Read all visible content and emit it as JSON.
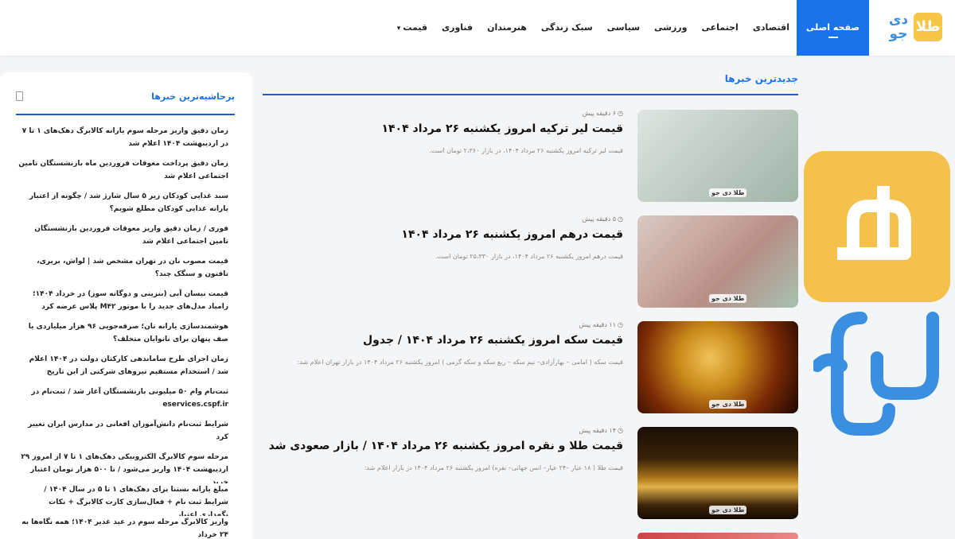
{
  "header": {
    "logo_text": "طلا",
    "logo_sub": "دی جو",
    "nav": [
      {
        "label": "صفحه اصلی",
        "active": true
      },
      {
        "label": "اقتصادی"
      },
      {
        "label": "اجتماعی"
      },
      {
        "label": "ورزشی"
      },
      {
        "label": "سیاسی"
      },
      {
        "label": "سبک زندگی"
      },
      {
        "label": "هنرمندان"
      },
      {
        "label": "فناوری"
      },
      {
        "label": "قیمت",
        "dropdown": true
      }
    ],
    "accent_color": "#1a73e8"
  },
  "main": {
    "section_title": "جدیدترین خبرها",
    "thumb_badge": "طلا دی جو",
    "items": [
      {
        "time": "۶ دقیقه پیش",
        "title": "قیمت لیر ترکیه امروز یکشنبه ۲۶ مرداد ۱۴۰۴",
        "summary": "قیمت لیر ترکیه امروز یکشنبه ۲۶ مرداد ۱۴۰۴، در بازار ۲،۳۶۰ تومان است."
      },
      {
        "time": "۵ دقیقه پیش",
        "title": "قیمت درهم امروز یکشنبه ۲۶ مرداد ۱۴۰۴",
        "summary": "قیمت درهم امروز یکشنبه ۲۶ مرداد ۱۴۰۴، در بازار ۲۵،۳۳۰ تومان است."
      },
      {
        "time": "۱۱ دقیقه پیش",
        "title": "قیمت سکه امروز یکشنبه ۲۶ مرداد ۱۴۰۴ / جدول",
        "summary": "قیمت سکه ( امامی – بهارآزادی– نیم سکه – ربع سکه و سکه گرمی ) امروز یکشنبه ۲۶ مرداد ۱۴۰۴ در بازار تهران اعلام شد:"
      },
      {
        "time": "۱۴ دقیقه پیش",
        "title": "قیمت طلا و نقره امروز یکشنبه ۲۶ مرداد ۱۴۰۴ / بازار صعودی شد",
        "summary": "قیمت طلا ( ۱۸ عیار –۲۴ عیار– انس جهانی– نقره) امروز یکشنبه ۲۶ مرداد ۱۴۰۴ در بازار اعلام شد:"
      }
    ]
  },
  "sidebar": {
    "title": "پرحاشیه‌ترین خبرها",
    "items": [
      "زمان دقیق واریز مرحله سوم یارانه کالابرگ دهک‌های ۱ تا ۷ در اردیبهشت ۱۴۰۴ اعلام شد",
      "زمان دقیق پرداخت معوقات فروردین ماه بازنشستگان تامین اجتماعی اعلام شد",
      "سبد غذایی کودکان زیر ۵ سال شارژ شد / چگونه از اعتبار یارانه غذایی کودکان مطلع شویم؟",
      "فوری / زمان دقیق واریز معوقات فروردین بازنشستگان تامین اجتماعی اعلام شد",
      "قیمت مصوب نان در تهران مشخص شد | لواش، بربری، تافتون و سنگک چند؟",
      "قیمت نیسان آبی (بنزینی و دوگانه سوز) در خرداد ۱۴۰۴؛ زامیاد مدل‌های جدید را با موتور M۴۲ پلاس عرضه کرد",
      "هوشمندسازی یارانه نان؛ صرفه‌جویی ۹۶ هزار میلیاردی یا صف پنهان برای نانوایان متخلف؟",
      "زمان اجرای طرح ساماندهی کارکنان دولت در ۱۴۰۴ اعلام شد / استخدام مستقیم نیروهای شرکتی از این تاریخ",
      "ثبت‌نام وام ۵۰ میلیونی بازنشستگان آغاز شد / ثبت‌نام در eservices.cspf.ir",
      "شرایط ثبت‌نام دانش‌آموزان افغانی در مدارس ایران تغییر کرد",
      "مرحله سوم کالابرگ الکترونیکی دهک‌های ۱ تا ۷ از امروز ۲۹ اردیبهشت ۱۴۰۴ واریز می‌شود / تا ۵۰۰ هزار تومان اعتبار خرید",
      "مبلغ یارانه بستنا برای دهک‌های ۱ تا ۵ در سال ۱۴۰۴ / شرایط ثبت نام + فعال‌سازی کارت کالابرگ + نکات نگهداری اعتبار",
      "واریز کالابرگ مرحله سوم در عید غدیر ۱۴۰۴؛ همه نگاه‌ها به ۲۴ خرداد"
    ]
  },
  "brand_colors": {
    "gold": "#f5c04b",
    "blue": "#3a8fe0"
  }
}
